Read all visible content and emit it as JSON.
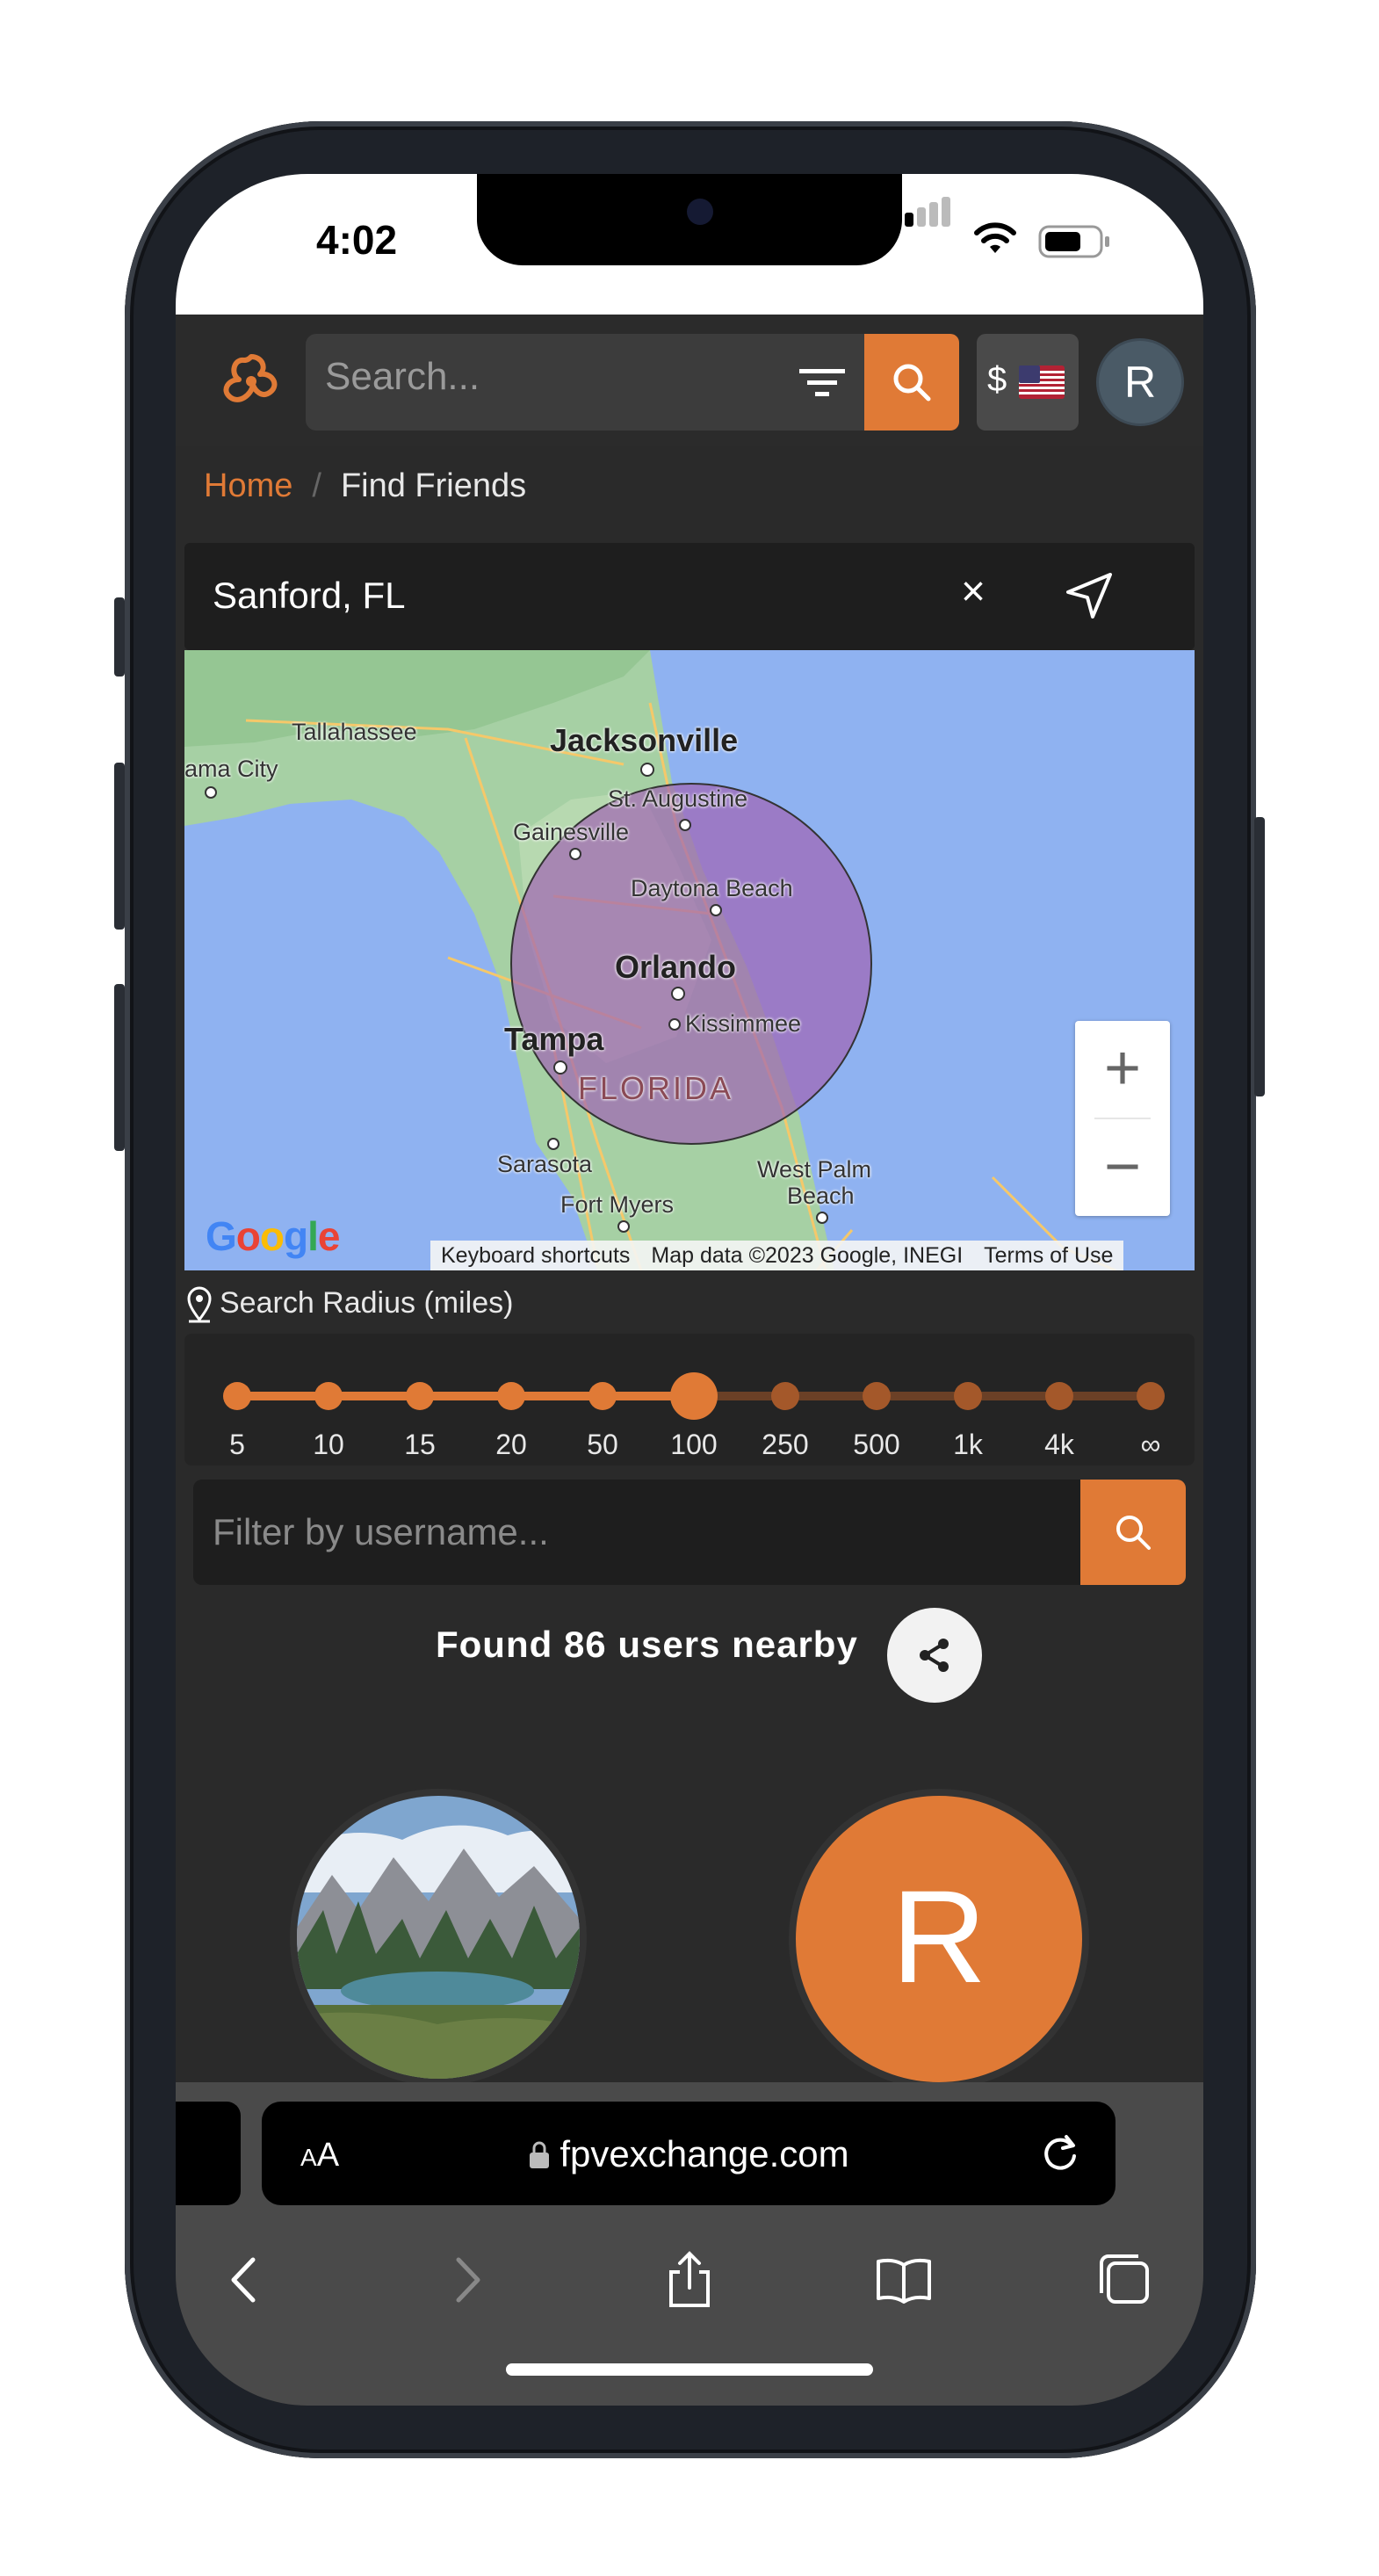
{
  "status": {
    "time": "4:02"
  },
  "header": {
    "search_placeholder": "Search...",
    "currency_symbol": "$",
    "avatar_letter": "R",
    "accent_color": "#e07a36"
  },
  "breadcrumb": {
    "home": "Home",
    "separator": "/",
    "current": "Find Friends"
  },
  "location": {
    "value": "Sanford, FL",
    "clear_icon": "×"
  },
  "map": {
    "labels": {
      "tallahassee": "Tallahassee",
      "panama": "ama City",
      "jacksonville": "Jacksonville",
      "st_augustine": "St. Augustine",
      "gainesville": "Gainesville",
      "daytona": "Daytona Beach",
      "orlando": "Orlando",
      "kissimmee": "Kissimmee",
      "tampa": "Tampa",
      "florida": "FLORIDA",
      "sarasota": "Sarasota",
      "west_palm": "West Palm",
      "beach": "Beach",
      "fort_myers": "Fort Myers"
    },
    "zoom_in": "+",
    "zoom_out": "−",
    "google": "Google",
    "attribution": {
      "shortcuts": "Keyboard shortcuts",
      "data": "Map data ©2023 Google, INEGI",
      "terms": "Terms of Use"
    }
  },
  "radius": {
    "title": "Search Radius (miles)",
    "options": [
      "5",
      "10",
      "15",
      "20",
      "50",
      "100",
      "250",
      "500",
      "1k",
      "4k",
      "∞"
    ],
    "selected": "100"
  },
  "filter": {
    "placeholder": "Filter by username..."
  },
  "results": {
    "text": "Found 86 users nearby",
    "user_letter": "R"
  },
  "safari": {
    "text_size": "AA",
    "url": "fpvexchange.com"
  }
}
